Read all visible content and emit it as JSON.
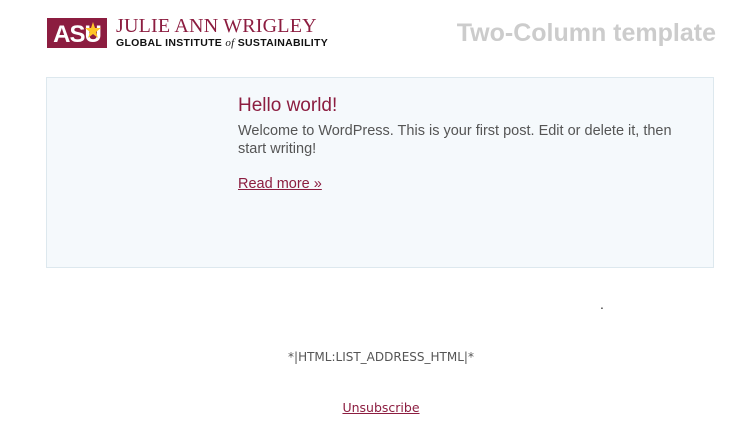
{
  "header": {
    "logo": {
      "mark_text": "ASU",
      "name": "JULIE ANN WRIGLEY",
      "sub_before": "GLOBAL INSTITUTE ",
      "sub_of": "of",
      "sub_after": " SUSTAINABILITY"
    },
    "template_title": "Two-Column template"
  },
  "post": {
    "title": "Hello world!",
    "excerpt": "Welcome to WordPress. This is your first post. Edit or delete it, then start writing!",
    "read_more": "Read more »"
  },
  "footer": {
    "dot": ".",
    "address": "*|HTML:LIST_ADDRESS_HTML|*",
    "unsubscribe": "Unsubscribe"
  },
  "colors": {
    "brand_maroon": "#8c1d40",
    "brand_gold": "#ffc627",
    "post_bg": "#f5f9fc",
    "template_title": "#cccccc"
  }
}
